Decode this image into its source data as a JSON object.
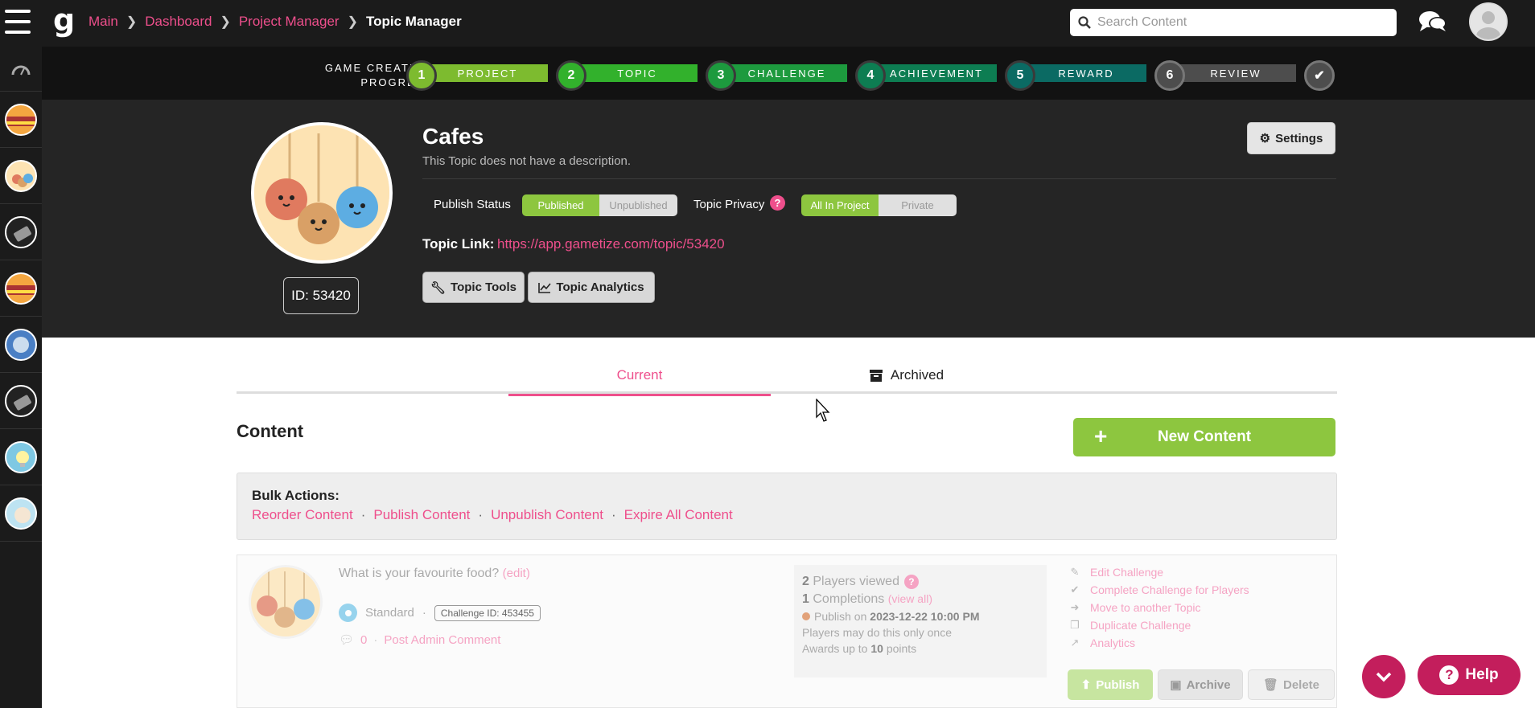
{
  "breadcrumb": {
    "items": [
      "Main",
      "Dashboard",
      "Project Manager"
    ],
    "current": "Topic Manager"
  },
  "search": {
    "placeholder": "Search Content"
  },
  "progress": {
    "label": "GAME CREATION PROGRESS",
    "steps": [
      {
        "num": "1",
        "label": "PROJECT",
        "color": "#7dbb2f"
      },
      {
        "num": "2",
        "label": "TOPIC",
        "color": "#32b12c"
      },
      {
        "num": "3",
        "label": "CHALLENGE",
        "color": "#1d9a3e"
      },
      {
        "num": "4",
        "label": "ACHIEVEMENT",
        "color": "#0d7d52"
      },
      {
        "num": "5",
        "label": "REWARD",
        "color": "#0b6a63"
      },
      {
        "num": "6",
        "label": "REVIEW",
        "color": "#4d4d4d"
      }
    ]
  },
  "topic": {
    "title": "Cafes",
    "description": "This Topic does not have a description.",
    "id_label": "ID: 53420",
    "settings_label": "Settings",
    "publish_status_label": "Publish Status",
    "published_label": "Published",
    "unpublished_label": "Unpublished",
    "privacy_label": "Topic Privacy",
    "privacy_on": "All In Project",
    "privacy_off": "Private",
    "link_label": "Topic Link:",
    "link_url": "https://app.gametize.com/topic/53420",
    "tools_label": "Topic Tools",
    "analytics_label": "Topic Analytics"
  },
  "tabs": {
    "current": "Current",
    "archived": "Archived"
  },
  "content": {
    "title": "Content",
    "new_button": "New Content",
    "bulk_title": "Bulk Actions:",
    "bulk_links": [
      "Reorder Content",
      "Publish Content",
      "Unpublish Content",
      "Expire All Content"
    ]
  },
  "challenge": {
    "question": "What is your favourite food?",
    "edit_label": "(edit)",
    "type": "Standard",
    "id_label": "Challenge ID: 453455",
    "comment_count": "0",
    "post_comment": "Post Admin Comment",
    "players_viewed_num": "2",
    "players_viewed_text": "Players viewed",
    "completions_num": "1",
    "completions_text": "Completions",
    "view_all": "(view all)",
    "publish_on_text": "Publish on",
    "publish_on_date": "2023-12-22 10:00 PM",
    "once_text": "Players may do this only once",
    "awards_text": "Awards up to",
    "awards_points": "10",
    "awards_suffix": "points",
    "actions": [
      "Edit Challenge",
      "Complete Challenge for Players",
      "Move to another Topic",
      "Duplicate Challenge",
      "Analytics"
    ],
    "publish_btn": "Publish",
    "archive_btn": "Archive",
    "delete_btn": "Delete"
  },
  "help": {
    "label": "Help"
  },
  "colors": {
    "accent": "#ee4f8c",
    "green": "#8dc63f",
    "help": "#c31e5c"
  }
}
